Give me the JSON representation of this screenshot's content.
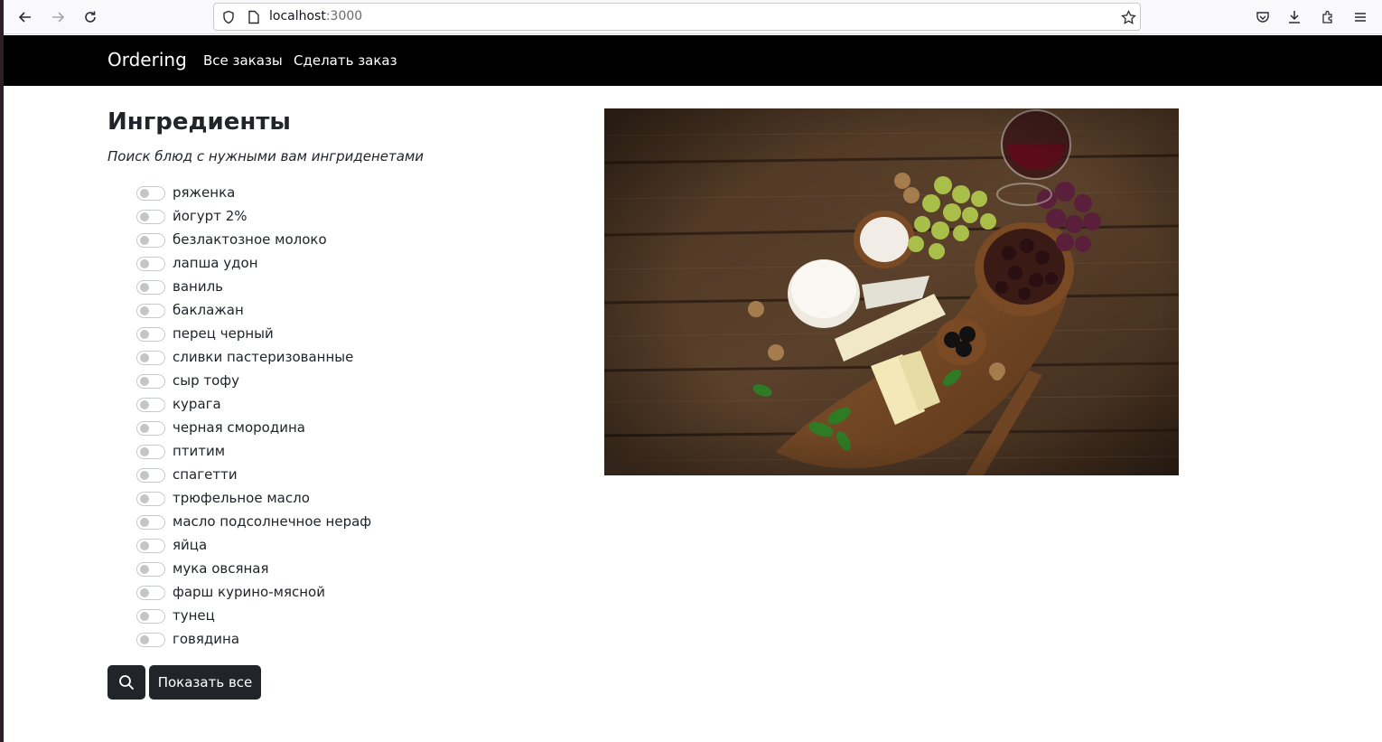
{
  "browser": {
    "url_host": "localhost",
    "url_port": ":3000"
  },
  "navbar": {
    "brand": "Ordering",
    "links": [
      "Все заказы",
      "Сделать заказ"
    ]
  },
  "page": {
    "title": "Ингредиенты",
    "subtitle": "Поиск блюд с нужными вам ингриденетами"
  },
  "ingredients": [
    {
      "label": "ряженка",
      "checked": false
    },
    {
      "label": "йогурт 2%",
      "checked": false
    },
    {
      "label": "безлактозное молоко",
      "checked": false
    },
    {
      "label": "лапша удон",
      "checked": false
    },
    {
      "label": "ваниль",
      "checked": false
    },
    {
      "label": "баклажан",
      "checked": false
    },
    {
      "label": "перец черный",
      "checked": false
    },
    {
      "label": "сливки пастеризованные",
      "checked": false
    },
    {
      "label": "сыр тофу",
      "checked": false
    },
    {
      "label": "курага",
      "checked": false
    },
    {
      "label": "черная смородина",
      "checked": false
    },
    {
      "label": "птитим",
      "checked": false
    },
    {
      "label": "спагетти",
      "checked": false
    },
    {
      "label": "трюфельное масло",
      "checked": false
    },
    {
      "label": "масло подсолнечное нераф",
      "checked": false
    },
    {
      "label": "яйца",
      "checked": false
    },
    {
      "label": "мука овсяная",
      "checked": false
    },
    {
      "label": "фарш курино-мясной",
      "checked": false
    },
    {
      "label": "тунец",
      "checked": false
    },
    {
      "label": "говядина",
      "checked": false
    }
  ],
  "buttons": {
    "search_icon": "search-icon",
    "show_all": "Показать все"
  },
  "colors": {
    "navbar": "#000000",
    "button": "#212529"
  }
}
